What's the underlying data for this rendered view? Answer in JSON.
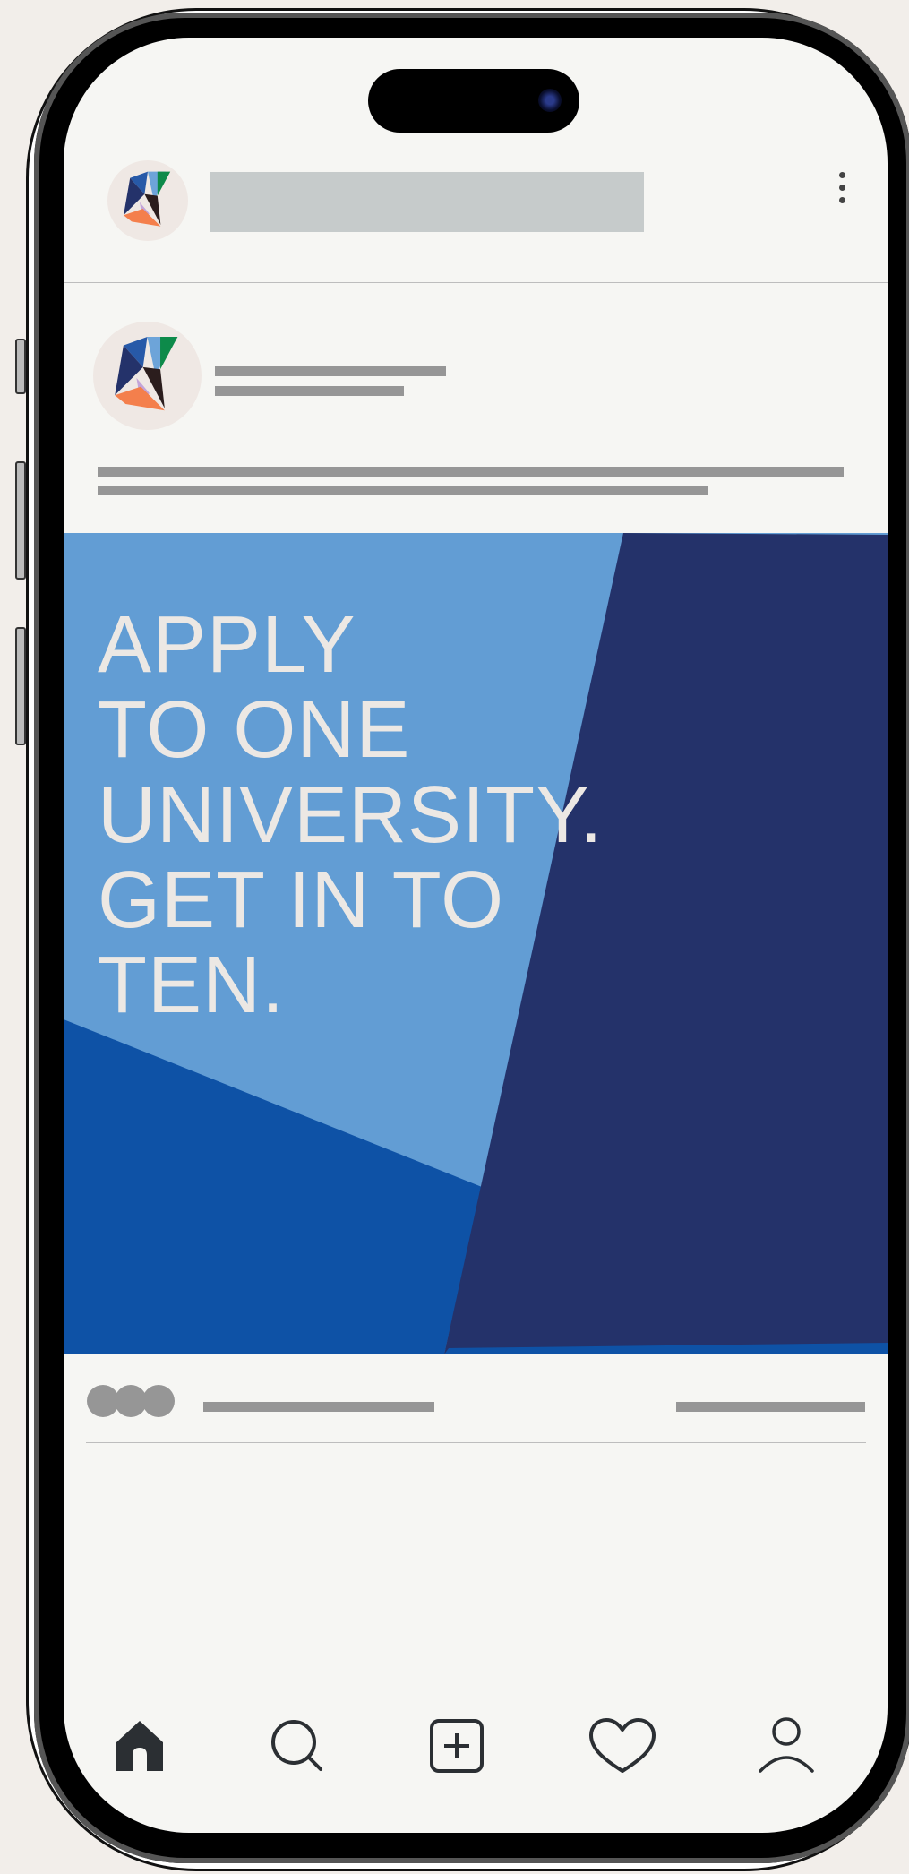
{
  "colors": {
    "screen_bg": "#f6f6f3",
    "placeholder_gray": "#969696",
    "title_placeholder": "#c6cbcb",
    "post_light_blue": "#629dd4",
    "post_navy": "#24326a",
    "post_royal_blue": "#0e52a6",
    "headline_text": "#ece8e4"
  },
  "post": {
    "headline_lines": [
      "APPLY",
      "TO ONE",
      "UNIVERSITY.",
      "GET IN TO",
      "TEN."
    ]
  },
  "header": {
    "menu_icon": "kebab-menu-icon"
  },
  "bottom_nav": {
    "items": [
      {
        "icon": "home-icon",
        "active": true
      },
      {
        "icon": "search-icon",
        "active": false
      },
      {
        "icon": "add-post-icon",
        "active": false
      },
      {
        "icon": "heart-icon",
        "active": false
      },
      {
        "icon": "profile-icon",
        "active": false
      }
    ]
  }
}
